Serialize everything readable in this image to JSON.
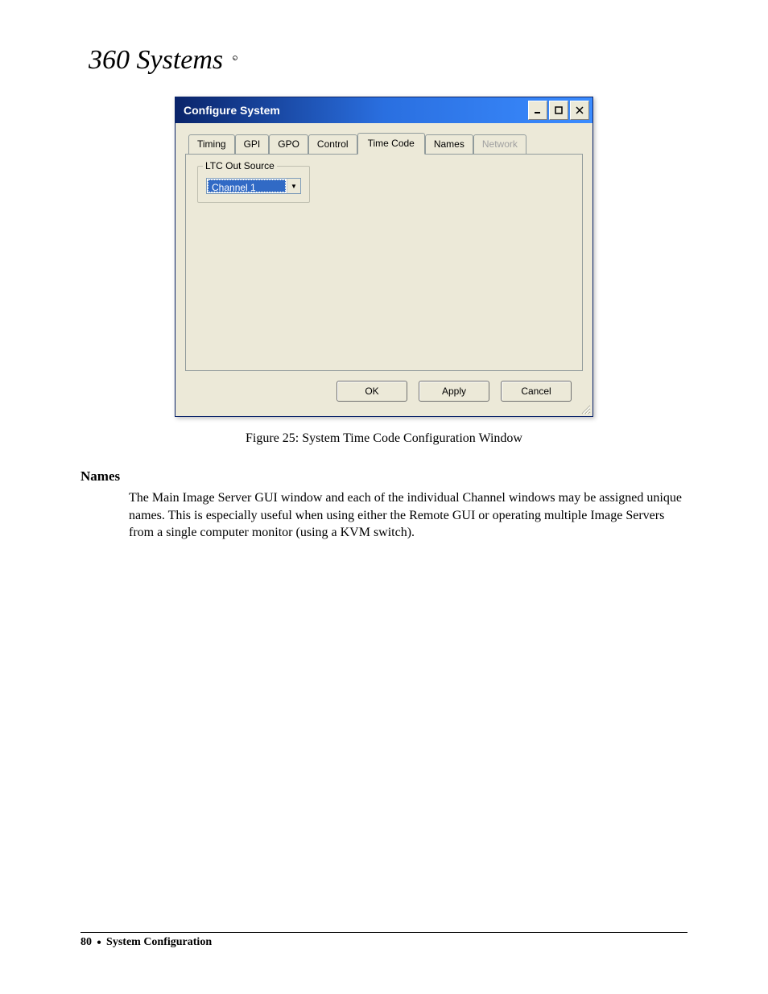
{
  "logo_text": "360 Systems",
  "dialog": {
    "title": "Configure System",
    "tabs": [
      "Timing",
      "GPI",
      "GPO",
      "Control",
      "Time Code",
      "Names",
      "Network"
    ],
    "active_tab_index": 4,
    "disabled_tab_indices": [
      6
    ],
    "groupbox_legend": "LTC Out Source",
    "dropdown_value": "Channel 1",
    "buttons": {
      "ok": "OK",
      "apply": "Apply",
      "cancel": "Cancel"
    }
  },
  "caption": "Figure 25:  System Time Code Configuration Window",
  "section_heading": "Names",
  "body_text": "The Main Image Server GUI window and each of the individual Channel windows may be assigned unique names.  This is especially useful when using either the Remote GUI or operating multiple Image Servers from a single computer monitor (using a KVM switch).",
  "footer": {
    "page_number": "80",
    "section": "System Configuration"
  }
}
